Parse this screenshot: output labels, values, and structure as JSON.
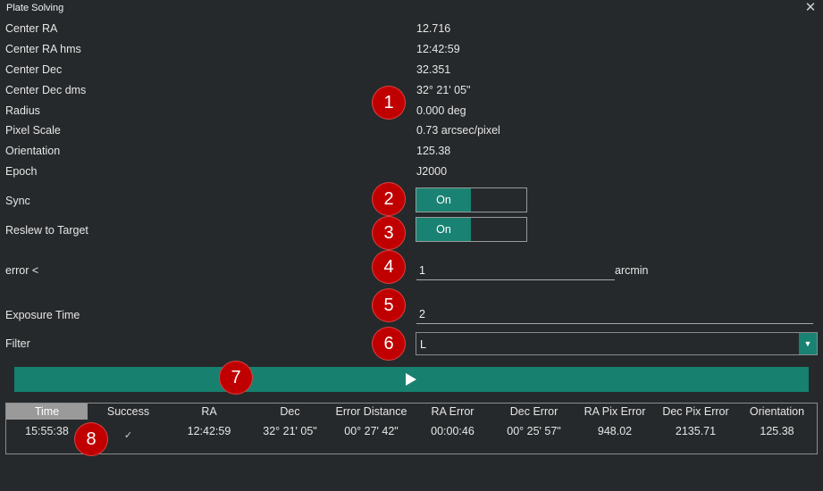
{
  "window": {
    "title": "Plate Solving",
    "close_icon": "✕"
  },
  "fields": {
    "center_ra": {
      "label": "Center RA",
      "value": "12.716"
    },
    "center_ra_hms": {
      "label": "Center RA hms",
      "value": "12:42:59"
    },
    "center_dec": {
      "label": "Center Dec",
      "value": "32.351"
    },
    "center_dec_dms": {
      "label": "Center Dec dms",
      "value": "32° 21' 05\""
    },
    "radius": {
      "label": "Radius",
      "value": "0.000 deg"
    },
    "pixel_scale": {
      "label": "Pixel Scale",
      "value": "0.73 arcsec/pixel"
    },
    "orientation": {
      "label": "Orientation",
      "value": "125.38"
    },
    "epoch": {
      "label": "Epoch",
      "value": "J2000"
    }
  },
  "sync": {
    "label": "Sync",
    "state": "On"
  },
  "reslew": {
    "label": "Reslew to Target",
    "state": "On"
  },
  "error_threshold": {
    "label": "error <",
    "value": "1",
    "unit": "arcmin"
  },
  "exposure": {
    "label": "Exposure Time",
    "value": "2"
  },
  "filter": {
    "label": "Filter",
    "selected": "L"
  },
  "solve_button": {
    "icon": "play-icon"
  },
  "table": {
    "columns": [
      "Time",
      "Success",
      "RA",
      "Dec",
      "Error Distance",
      "RA Error",
      "Dec Error",
      "RA Pix Error",
      "Dec Pix Error",
      "Orientation"
    ],
    "rows": [
      {
        "time": "15:55:38",
        "success": "✓",
        "ra": "12:42:59",
        "dec": "32° 21' 05\"",
        "error_distance": "00° 27' 42\"",
        "ra_error": "00:00:46",
        "dec_error": "00° 25' 57\"",
        "ra_pix_error": "948.02",
        "dec_pix_error": "2135.71",
        "orientation": "125.38"
      }
    ]
  },
  "annotations": [
    "1",
    "2",
    "3",
    "4",
    "5",
    "6",
    "7",
    "8"
  ],
  "colors": {
    "accent": "#1a8273",
    "background": "#26292b",
    "badge": "#c00000"
  }
}
